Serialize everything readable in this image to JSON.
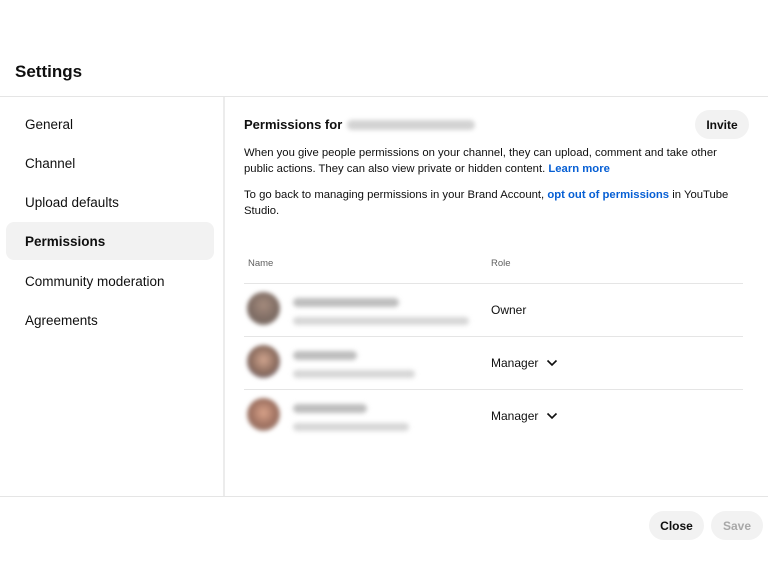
{
  "dialog": {
    "title": "Settings"
  },
  "sidebar": {
    "items": [
      {
        "label": "General"
      },
      {
        "label": "Channel"
      },
      {
        "label": "Upload defaults"
      },
      {
        "label": "Permissions",
        "active": true
      },
      {
        "label": "Community moderation"
      },
      {
        "label": "Agreements"
      }
    ]
  },
  "permissions": {
    "heading": "Permissions for",
    "invite_label": "Invite",
    "description": "When you give people permissions on your channel, they can upload, comment and take other public actions. They can also view private or hidden content.",
    "learn_more": "Learn more",
    "brand_text_before": "To go back to managing permissions in your Brand Account,",
    "brand_link": "opt out of permissions",
    "brand_text_after": "in YouTube Studio.",
    "columns": {
      "name": "Name",
      "role": "Role"
    },
    "users": [
      {
        "role": "Owner"
      },
      {
        "role": "Manager"
      },
      {
        "role": "Manager"
      }
    ]
  },
  "footer": {
    "close_label": "Close",
    "save_label": "Save"
  },
  "colors": {
    "link": "#065fd4",
    "active_bg": "#f2f2f2",
    "disabled_text": "#a8a8a8"
  },
  "icons": {
    "role_dropdown": "chevron-down-icon"
  }
}
